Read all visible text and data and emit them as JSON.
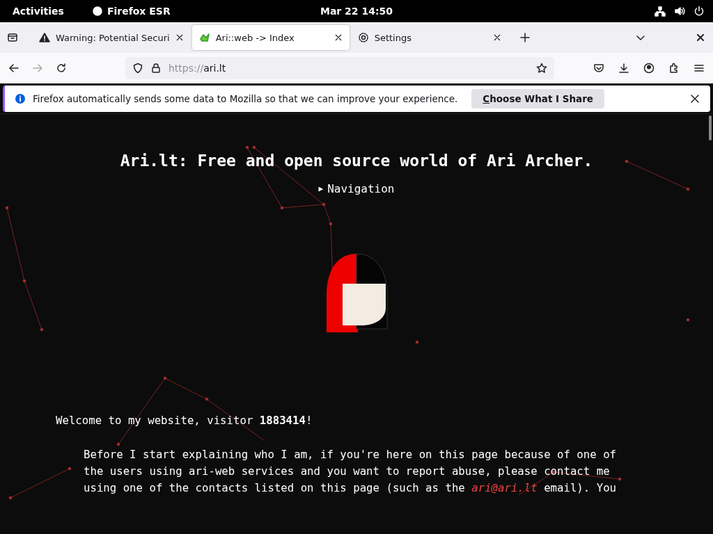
{
  "topbar": {
    "activities": "Activities",
    "app": "Firefox ESR",
    "clock": "Mar 22  14:50"
  },
  "tabs": [
    {
      "kind": "warning",
      "label": "Warning: Potential Securi",
      "selected": false
    },
    {
      "kind": "site",
      "label": "Ari::web -> Index",
      "selected": true
    },
    {
      "kind": "settings",
      "label": "Settings",
      "selected": false
    }
  ],
  "url": {
    "scheme": "https://",
    "host": "ari.lt"
  },
  "notification": {
    "message": "Firefox automatically sends some data to Mozilla so that we can improve your experience.",
    "button_key": "C",
    "button_rest": "hoose What I Share"
  },
  "page": {
    "title": "Ari.lt: Free and open source world of Ari Archer.",
    "navigation": {
      "marker": "▶",
      "label": "Navigation",
      "expanded": false
    },
    "welcome": "Welcome to my website, visitor **1883414**!",
    "paragraph_before": "Before I start explaining who I am, if you're here on this page because of one of the users using ari-web services and you want to report abuse, please contact me using one of the contacts listed on this page (such as the ",
    "paragraph_link": "ari@ari.lt",
    "paragraph_after": " email). You"
  }
}
